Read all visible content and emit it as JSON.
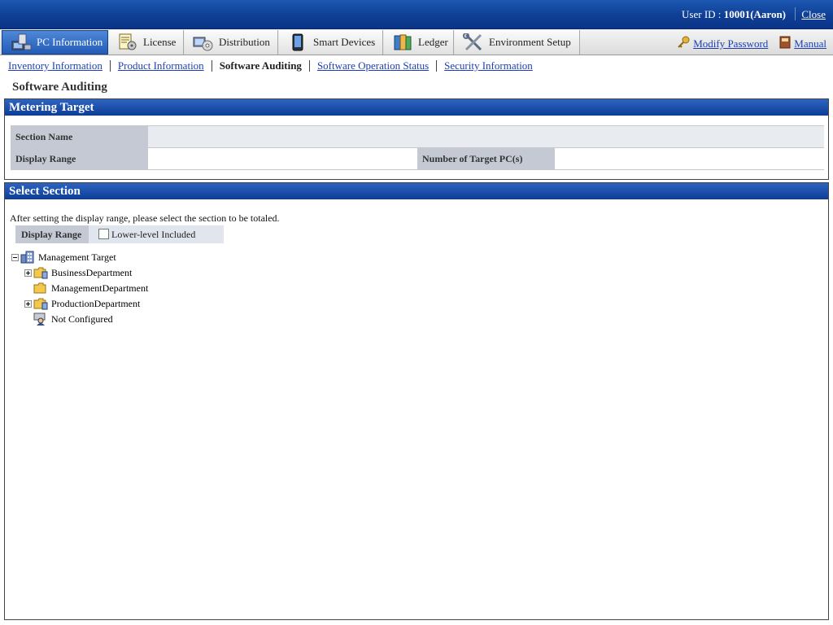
{
  "header": {
    "user_prefix": "User ID : ",
    "user_id": "10001(Aaron)",
    "close_label": "Close"
  },
  "tabs": [
    {
      "label": "PC Information",
      "icon": "pc-icon",
      "active": true
    },
    {
      "label": "License",
      "icon": "license-icon",
      "active": false
    },
    {
      "label": "Distribution",
      "icon": "distribution-icon",
      "active": false
    },
    {
      "label": "Smart Devices",
      "icon": "smartphone-icon",
      "active": false
    },
    {
      "label": "Ledger",
      "icon": "ledger-icon",
      "active": false
    },
    {
      "label": "Environment Setup",
      "icon": "tools-icon",
      "active": false
    }
  ],
  "right_links": {
    "modify_password": "Modify Password",
    "manual": "Manual"
  },
  "subnav": [
    {
      "label": "Inventory Information",
      "current": false
    },
    {
      "label": "Product Information",
      "current": false
    },
    {
      "label": "Software Auditing",
      "current": true
    },
    {
      "label": "Software Operation Status",
      "current": false
    },
    {
      "label": "Security Information",
      "current": false
    }
  ],
  "page_title": "Software Auditing",
  "metering": {
    "title": "Metering Target",
    "section_name_label": "Section Name",
    "section_name_value": "",
    "display_range_label": "Display Range",
    "display_range_value": "",
    "target_pcs_label": "Number of Target PC(s)",
    "target_pcs_value": ""
  },
  "select_section": {
    "title": "Select Section",
    "instruction": "After setting the display range, please select the section to be totaled.",
    "display_range_label": "Display Range",
    "lower_level_label": "Lower-level Included",
    "lower_level_checked": false,
    "tree": [
      {
        "label": "Management Target",
        "level": 0,
        "expander": "minus",
        "icon": "building-icon"
      },
      {
        "label": "BusinessDepartment",
        "level": 1,
        "expander": "plus",
        "icon": "folder-icon"
      },
      {
        "label": "ManagementDepartment",
        "level": 1,
        "expander": "none",
        "icon": "folder-icon"
      },
      {
        "label": "ProductionDepartment",
        "level": 1,
        "expander": "plus",
        "icon": "folder-icon"
      },
      {
        "label": "Not Configured",
        "level": 1,
        "expander": "none",
        "icon": "unassigned-icon"
      }
    ]
  }
}
